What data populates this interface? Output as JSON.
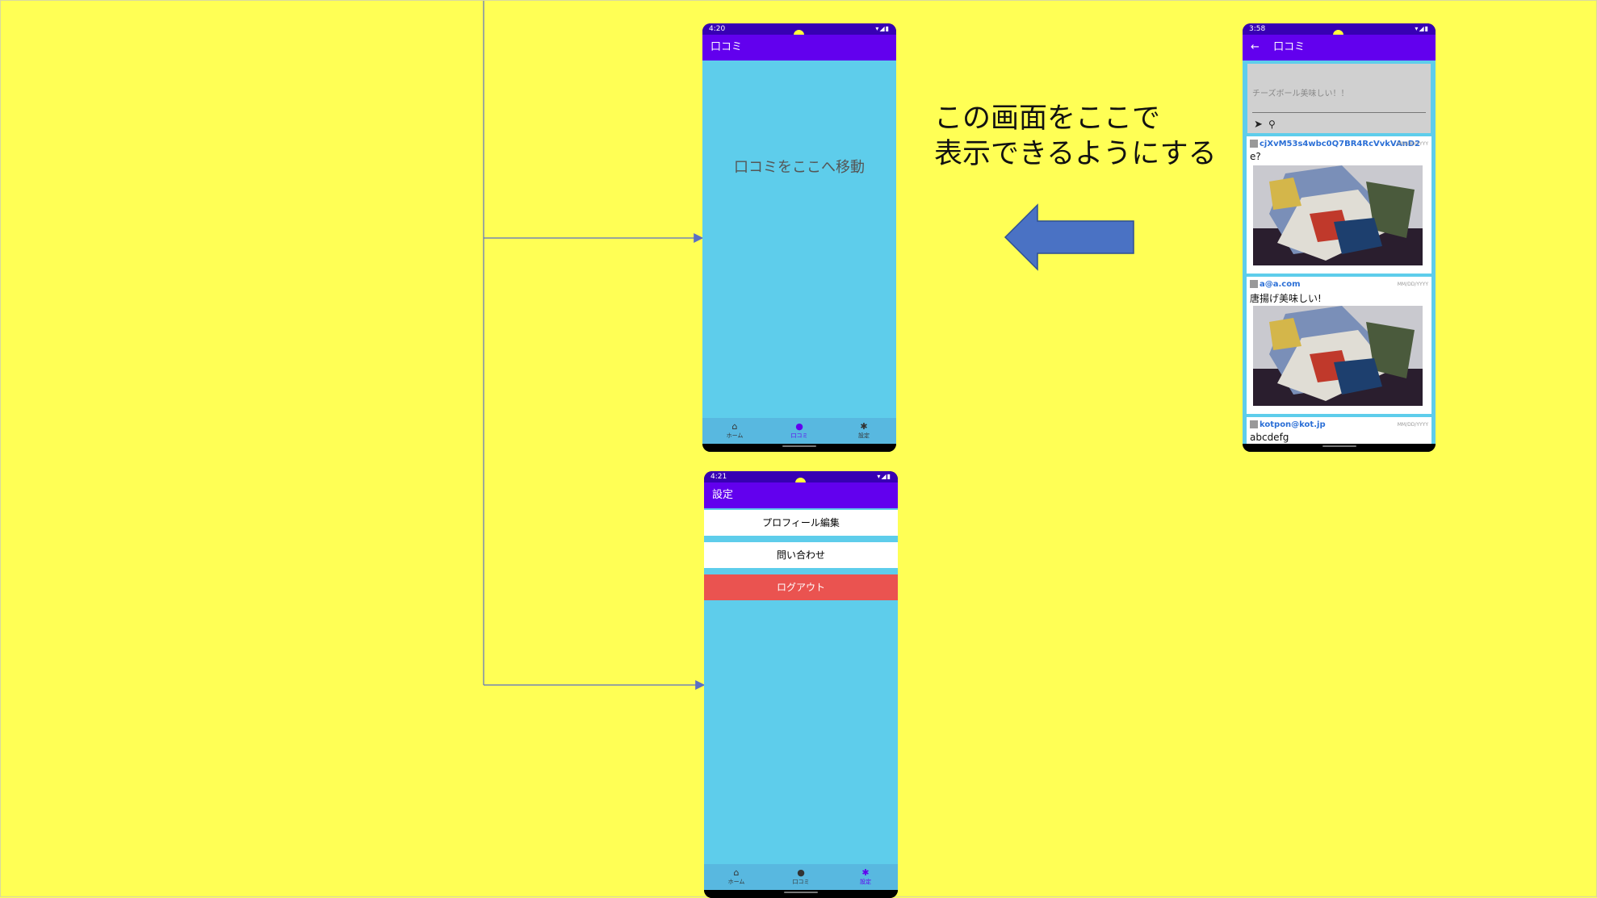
{
  "annotation": {
    "line1": "この画面をここで",
    "line2": "表示できるようにする"
  },
  "colors": {
    "background": "#ffff55",
    "appbar": "#6200ee",
    "statusbar": "#3700b3",
    "content": "#5ecdeb",
    "logout": "#ea5350",
    "arrow": "#4a72c4",
    "connector": "#5a6fc5"
  },
  "phone_review": {
    "status_time": "4:20",
    "title": "口コミ",
    "placeholder": "口コミをここへ移動",
    "nav": [
      {
        "icon": "home-icon",
        "label": "ホーム"
      },
      {
        "icon": "person-icon",
        "label": "口コミ"
      },
      {
        "icon": "gear-icon",
        "label": "設定"
      }
    ],
    "active_tab": 1
  },
  "phone_settings": {
    "status_time": "4:21",
    "title": "設定",
    "buttons": {
      "edit_profile": "プロフィール編集",
      "contact": "問い合わせ",
      "logout": "ログアウト"
    },
    "nav": [
      {
        "icon": "home-icon",
        "label": "ホーム"
      },
      {
        "icon": "person-icon",
        "label": "口コミ"
      },
      {
        "icon": "gear-icon",
        "label": "設定"
      }
    ],
    "active_tab": 2
  },
  "phone_feed": {
    "status_time": "3:58",
    "back_icon": "arrow-back-icon",
    "title": "口コミ",
    "input_placeholder": "チーズボール美味しい！！",
    "posts": [
      {
        "user": "cjXvM53s4wbc0Q7BR4RcVvkVAnD2",
        "date": "MM/DD/YYYY",
        "text": "e?"
      },
      {
        "user": "a@a.com",
        "date": "MM/DD/YYYY",
        "text": "唐揚げ美味しい!"
      },
      {
        "user": "kotpon@kot.jp",
        "date": "MM/DD/YYYY",
        "text": "abcdefg"
      }
    ]
  }
}
